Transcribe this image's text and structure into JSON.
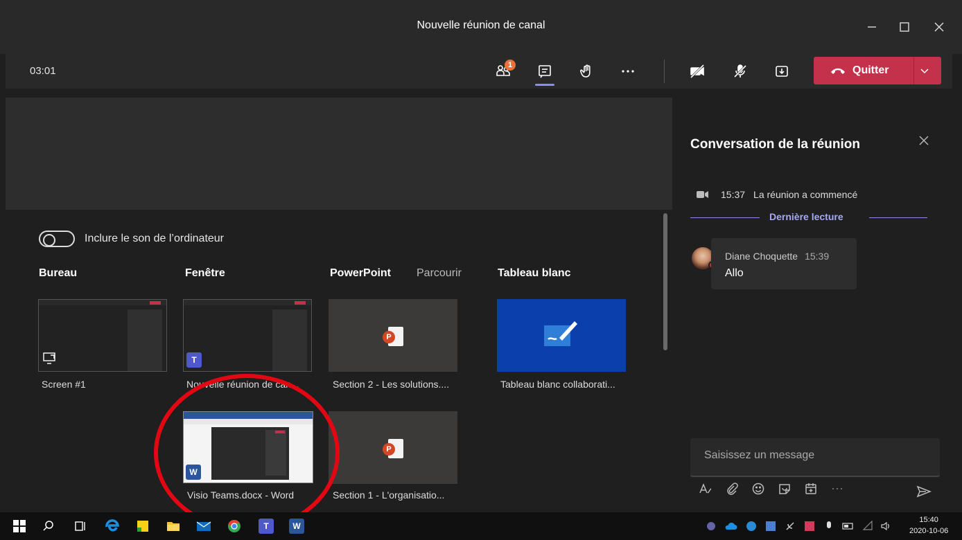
{
  "window": {
    "title": "Nouvelle réunion de canal"
  },
  "toolbar": {
    "timer": "03:01",
    "participants_badge": "1",
    "quit_label": "Quitter"
  },
  "share_tray": {
    "include_audio_label": "Inclure le son de l’ordinateur",
    "columns": {
      "desktop": "Bureau",
      "window": "Fenêtre",
      "powerpoint": "PowerPoint",
      "browse": "Parcourir",
      "whiteboard": "Tableau blanc"
    },
    "items": {
      "screen1": "Screen #1",
      "window_teams": "Nouvelle réunion de can...",
      "window_word": "Visio Teams.docx - Word",
      "ppt_section2": "Section 2 - Les solutions....",
      "ppt_section1": "Section 1 - L'organisatio...",
      "whiteboard": "Tableau blanc collaborati..."
    }
  },
  "chat": {
    "title": "Conversation de la réunion",
    "system_time": "15:37",
    "system_message": "La réunion a commencé",
    "last_read": "Dernière lecture",
    "message": {
      "author": "Diane Choquette",
      "time": "15:39",
      "text": "Allo"
    },
    "compose_placeholder": "Saisissez un message"
  },
  "taskbar": {
    "clock_time": "15:40",
    "clock_date": "2020-10-06"
  },
  "colors": {
    "accent": "#8b8cf5",
    "quit_red": "#c4314b",
    "annotation_red": "#e30613",
    "whiteboard_blue": "#0b3fab"
  }
}
